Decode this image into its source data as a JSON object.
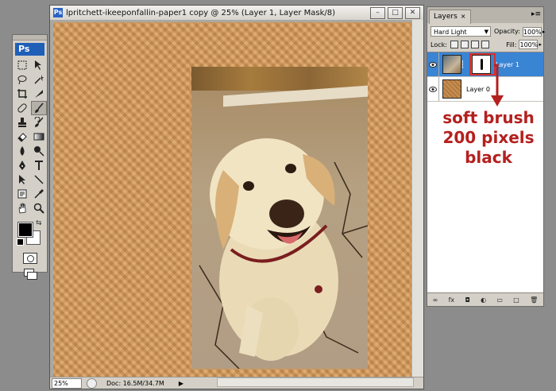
{
  "tools": {
    "logo": "Ps",
    "items": [
      "marquee",
      "move",
      "lasso",
      "magic-wand",
      "crop",
      "slice",
      "healing",
      "brush",
      "clone-stamp",
      "history-brush",
      "eraser",
      "gradient",
      "blur",
      "dodge",
      "pen",
      "type",
      "path-select",
      "line",
      "notes",
      "eyedropper",
      "hand",
      "zoom"
    ],
    "selected": "brush",
    "foreground": "#000000",
    "background": "#ffffff"
  },
  "document": {
    "title": "lpritchett-ikeeponfallin-paper1 copy @ 25% (Layer 1, Layer Mask/8)",
    "status": {
      "zoom": "25%",
      "doc_info": "Doc: 16.5M/34.7M"
    }
  },
  "layers_panel": {
    "tab_label": "Layers",
    "blend_mode": "Hard Light",
    "opacity_label": "Opacity:",
    "opacity_value": "100%",
    "lock_label": "Lock:",
    "fill_label": "Fill:",
    "fill_value": "100%",
    "layers": [
      {
        "name": "Layer 1",
        "active": true
      },
      {
        "name": "Layer 0",
        "active": false
      }
    ]
  },
  "annotation": {
    "lines": [
      "soft brush",
      "200 pixels",
      "black"
    ],
    "color": "#b4201e"
  },
  "colors": {
    "selection": "#3a84d4",
    "canvas_paper": "#d19a5f"
  }
}
